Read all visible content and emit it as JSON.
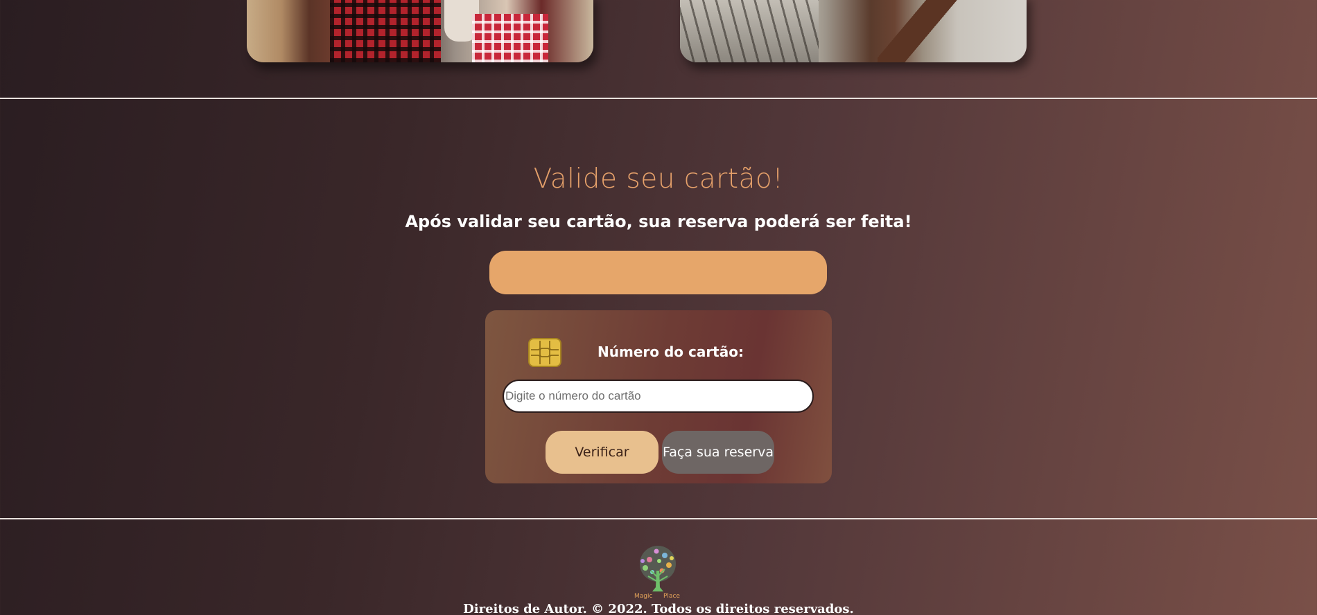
{
  "validation": {
    "title": "Valide seu cartão!",
    "subtitle": "Após validar seu cartão, sua reserva poderá ser feita!",
    "status_bar_text": ""
  },
  "card_form": {
    "label": "Número do cartão:",
    "input_placeholder": "Digite o número do cartão",
    "input_value": "",
    "verify_button": "Verificar",
    "reserve_button": "Faça sua reserva"
  },
  "footer": {
    "logo_text_left": "Magic",
    "logo_text_right": "Place",
    "copyright": "Direitos de Autor. © 2022. Todos os direitos reservados."
  },
  "colors": {
    "title": "#e5a06a",
    "orange_bar": "#e6a66a",
    "verify_button": "#e8c08e",
    "reserve_button": "#6e6664",
    "chip": "#e3bd43"
  },
  "icons": {
    "chip": "card-chip-icon",
    "logo": "magic-place-tree-logo"
  }
}
